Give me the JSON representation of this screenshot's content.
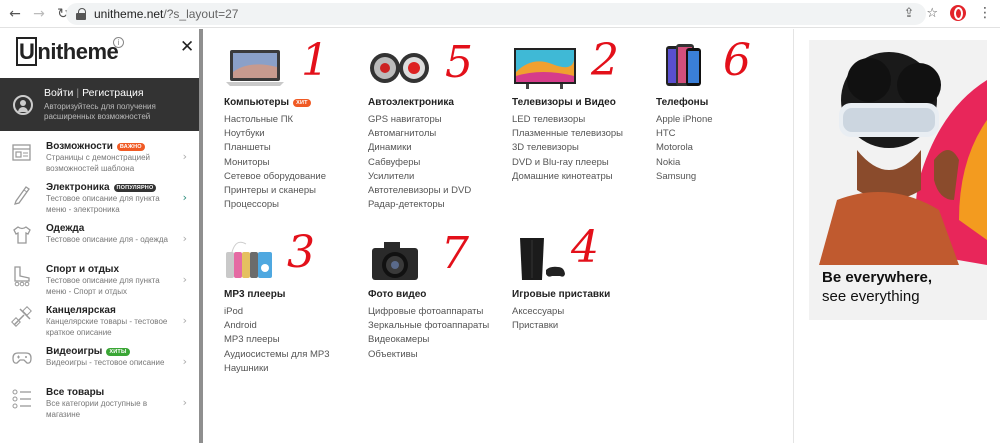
{
  "browser": {
    "url_host": "unitheme.net",
    "url_path": "/?s_layout=27",
    "back_icon": "arrow-left-icon",
    "forward_icon": "arrow-right-icon",
    "reload_icon": "reload-icon"
  },
  "logo": {
    "text": "Unitheme",
    "info": "i"
  },
  "auth": {
    "login": "Войти",
    "separator": "|",
    "register": "Регистрация",
    "hint_line1": "Авторизуйтесь для получения",
    "hint_line2": "расширенных возможностей"
  },
  "sidebar": {
    "items": [
      {
        "title": "Возможности",
        "badge": "Важно",
        "badge_color": "#f05a24",
        "desc1": "Страницы с демонстрацией",
        "desc2": "возможностей шаблона",
        "icon": "layout-icon"
      },
      {
        "title": "Электроника",
        "badge": "Популярно",
        "badge_color": "#333333",
        "desc1": "Тестовое описание для пункта",
        "desc2": "меню - электроника",
        "icon": "pen-icon"
      },
      {
        "title": "Одежда",
        "badge": "",
        "desc1": "Тестовое описание для - одежда",
        "desc2": "",
        "icon": "tshirt-icon"
      },
      {
        "title": "Спорт и отдых",
        "badge": "",
        "desc1": "Тестовое описание для пункта",
        "desc2": "меню - Спорт и отдых",
        "icon": "rollerskate-icon"
      },
      {
        "title": "Канцелярская",
        "badge": "",
        "desc1": "Канцелярские товары - тестовое",
        "desc2": "краткое описание",
        "icon": "tools-icon"
      },
      {
        "title": "Видеоигры",
        "badge": "Хиты",
        "badge_color": "#3aa635",
        "desc1": "Видеоигры - тестовое описание",
        "desc2": "",
        "icon": "gamepad-icon"
      },
      {
        "title": "Все товары",
        "badge": "",
        "desc1": "Все категории доступные в",
        "desc2": "магазине",
        "icon": "list-icon"
      }
    ]
  },
  "categories": [
    {
      "title": "Компьютеры",
      "badge": "Хит",
      "number": "1",
      "items": [
        "Настольные ПК",
        "Ноутбуки",
        "Планшеты",
        "Мониторы",
        "Сетевое оборудование",
        "Принтеры и сканеры",
        "Процессоры"
      ]
    },
    {
      "title": "Автоэлектроника",
      "badge": "",
      "number": "5",
      "items": [
        "GPS навигаторы",
        "Автомагнитолы",
        "Динамики",
        "Сабвуферы",
        "Усилители",
        "Автотелевизоры и DVD",
        "Радар-детекторы"
      ]
    },
    {
      "title": "Телевизоры и Видео",
      "badge": "",
      "number": "2",
      "items": [
        "LED телевизоры",
        "Плазменные телевизоры",
        "3D телевизоры",
        "DVD и Blu-ray плееры",
        "Домашние кинотеатры"
      ]
    },
    {
      "title": "Телефоны",
      "badge": "",
      "number": "6",
      "items": [
        "Apple iPhone",
        "HTC",
        "Motorola",
        "Nokia",
        "Samsung"
      ]
    },
    {
      "title": "MP3 плееры",
      "badge": "",
      "number": "3",
      "items": [
        "iPod",
        "Android",
        "MP3 плееры",
        "Аудиосистемы для MP3",
        "Наушники"
      ]
    },
    {
      "title": "Фото видео",
      "badge": "",
      "number": "7",
      "items": [
        "Цифровые фотоаппараты",
        "Зеркальные фотоаппараты",
        "Видеокамеры",
        "Объективы"
      ]
    },
    {
      "title": "Игровые приставки",
      "badge": "",
      "number": "4",
      "items": [
        "Аксессуары",
        "Приставки"
      ]
    }
  ],
  "promo": {
    "headline": "Be everywhere,",
    "subline": "see everything"
  },
  "colors": {
    "accent_red": "#e3101a",
    "badge_orange": "#f05a24",
    "badge_green": "#3aa635",
    "auth_bg": "#333333"
  }
}
